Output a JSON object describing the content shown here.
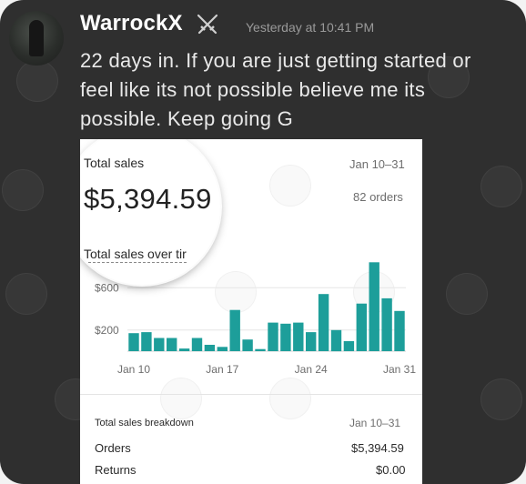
{
  "post": {
    "username": "WarrockX",
    "badge_icon": "crossed-swords-icon",
    "timestamp": "Yesterday at 10:41 PM",
    "message": "22 days in. If you are just getting started or feel like its not possible believe me its possible. Keep going G"
  },
  "report": {
    "total_sales_label": "Total sales",
    "total_sales_value": "$5,394.59",
    "date_range": "Jan 10–31",
    "orders_count": "82 orders",
    "chart_title": "Total sales over tir"
  },
  "chart_data": {
    "type": "bar",
    "color": "#1d9e9a",
    "xlabel": "",
    "ylabel": "",
    "ylim": [
      0,
      800
    ],
    "ytick_labels": [
      "$600",
      "$200"
    ],
    "yticks": [
      600,
      200
    ],
    "xtick_labels": [
      "Jan 10",
      "Jan 17",
      "Jan 24",
      "Jan 31"
    ],
    "categories": [
      "Jan 10",
      "Jan 11",
      "Jan 12",
      "Jan 13",
      "Jan 14",
      "Jan 15",
      "Jan 16",
      "Jan 17",
      "Jan 18",
      "Jan 19",
      "Jan 20",
      "Jan 21",
      "Jan 22",
      "Jan 23",
      "Jan 24",
      "Jan 25",
      "Jan 26",
      "Jan 27",
      "Jan 28",
      "Jan 29",
      "Jan 30",
      "Jan 31"
    ],
    "values": [
      170,
      180,
      125,
      125,
      25,
      125,
      60,
      40,
      390,
      110,
      20,
      270,
      260,
      270,
      180,
      540,
      200,
      95,
      450,
      840,
      500,
      380
    ]
  },
  "breakdown": {
    "title": "Total sales breakdown",
    "date_range": "Jan 10–31",
    "rows": [
      {
        "label": "Orders",
        "value": "$5,394.59"
      },
      {
        "label": "Returns",
        "value": "$0.00"
      }
    ]
  }
}
